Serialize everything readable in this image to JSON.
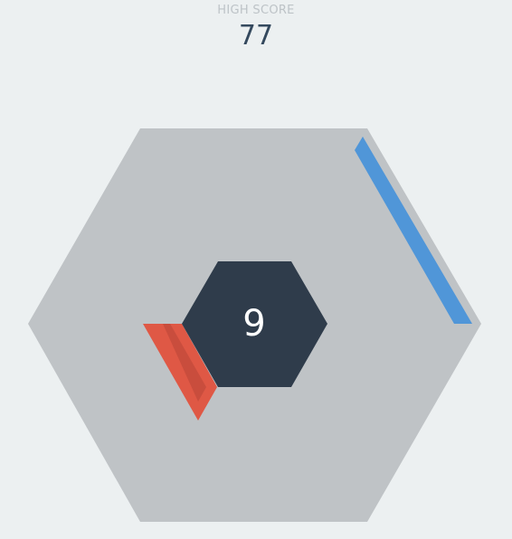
{
  "header": {
    "high_score_label": "HIGH SCORE",
    "high_score_value": "77"
  },
  "game": {
    "current_score": "9",
    "colors": {
      "background": "#ecf0f1",
      "outer_hexagon": "#bfc3c6",
      "inner_hexagon": "#2f3c4b",
      "score_text": "#ffffff",
      "block_blue": "#5096d8",
      "block_red": "#df5845",
      "block_red_shade": "#c94d3d"
    },
    "blocks": [
      {
        "color": "blue",
        "side": "upper-right"
      },
      {
        "color": "red",
        "side": "lower-left"
      }
    ]
  }
}
